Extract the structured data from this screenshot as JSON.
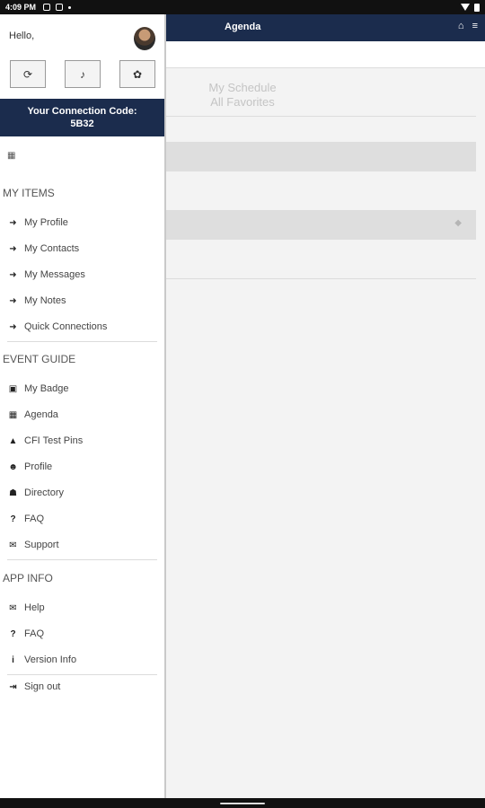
{
  "status_bar": {
    "time": "4:09 PM"
  },
  "header": {
    "title": "Agenda",
    "icons": [
      "home-icon",
      "menu-icon"
    ]
  },
  "schedule": {
    "my_schedule": "My Schedule",
    "all_favorites": "All Favorites"
  },
  "drawer": {
    "greeting": "Hello,",
    "quick_buttons": [
      "refresh-icon",
      "bell-icon",
      "gear-icon"
    ],
    "connection_label": "Your Connection Code:",
    "connection_code": "5B32",
    "my_items": {
      "title": "MY ITEMS",
      "items": [
        "My Profile",
        "My Contacts",
        "My Messages",
        "My Notes",
        "Quick Connections"
      ]
    },
    "event_guide": {
      "title": "EVENT GUIDE",
      "items": [
        "My Badge",
        "Agenda",
        "CFI Test Pins",
        "Profile",
        "Directory",
        "FAQ",
        "Support"
      ]
    },
    "app_info": {
      "title": "APP INFO",
      "items": [
        "Help",
        "FAQ",
        "Version Info"
      ]
    },
    "sign_out": "Sign out"
  }
}
